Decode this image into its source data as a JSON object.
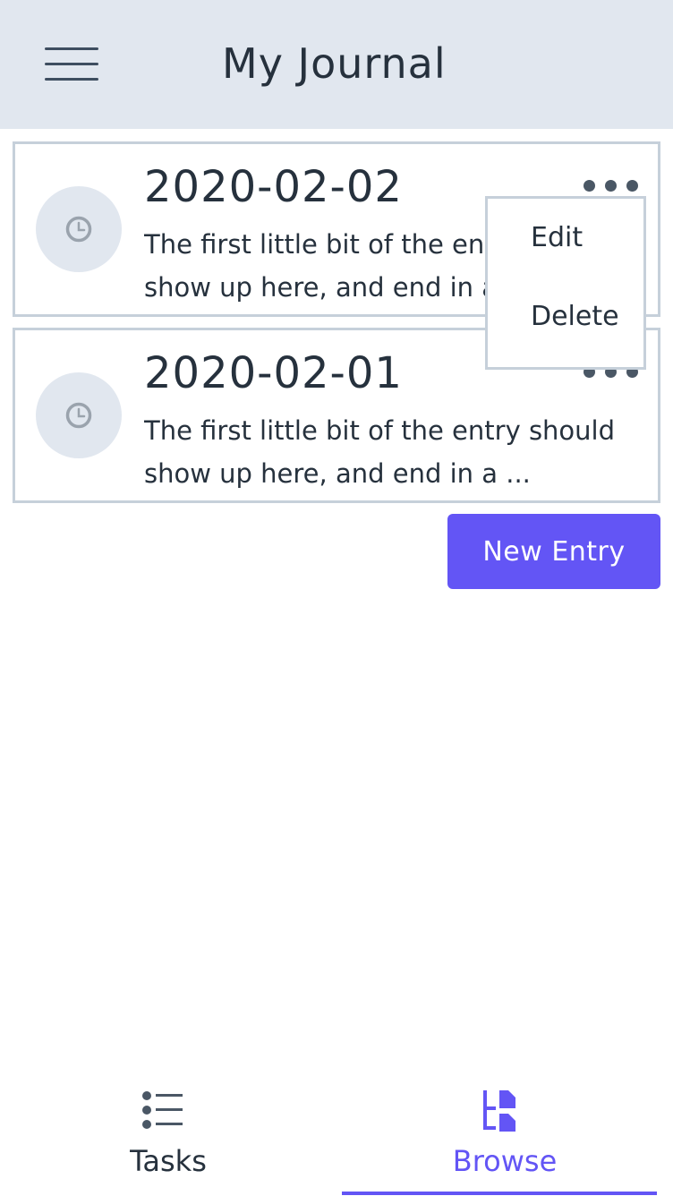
{
  "header": {
    "menu_icon": "hamburger-menu-icon",
    "title": "My Journal"
  },
  "entries": [
    {
      "icon": "clock-icon",
      "date": "2020-02-02",
      "preview_line1": "The first little bit of the entry should",
      "preview_line2": "show up here, and end in a ..."
    },
    {
      "icon": "clock-icon",
      "date": "2020-02-01",
      "preview_line1": "The first little bit of the entry should",
      "preview_line2": "show up here, and end in a ..."
    }
  ],
  "popup_menu": {
    "edit_label": "Edit",
    "delete_label": "Delete"
  },
  "new_entry_label": "New Entry",
  "bottom_nav": {
    "tasks": {
      "label": "Tasks",
      "icon": "list-icon"
    },
    "browse": {
      "label": "Browse",
      "icon": "tree-browse-icon",
      "active": true
    }
  },
  "colors": {
    "header_bg": "#e1e7ef",
    "accent": "#6355f5",
    "text": "#26313d",
    "border": "#c6d0da"
  }
}
